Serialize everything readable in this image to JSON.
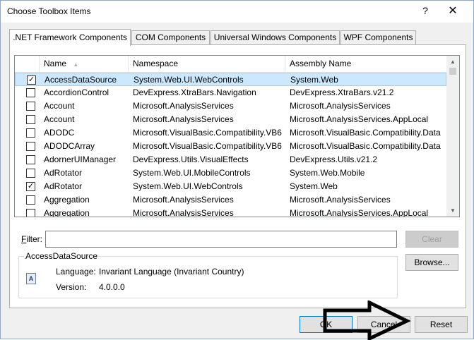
{
  "window": {
    "title": "Choose Toolbox Items",
    "help_glyph": "?",
    "close_glyph": "✕"
  },
  "tabs": [
    {
      "label": ".NET Framework Components",
      "active": true
    },
    {
      "label": "COM Components",
      "active": false
    },
    {
      "label": "Universal Windows Components",
      "active": false
    },
    {
      "label": "WPF Components",
      "active": false
    }
  ],
  "list": {
    "columns": [
      "Name",
      "Namespace",
      "Assembly Name"
    ],
    "rows": [
      {
        "checked": true,
        "name": "AccessDataSource",
        "namespace": "System.Web.UI.WebControls",
        "assembly": "System.Web",
        "selected": true
      },
      {
        "checked": false,
        "name": "AccordionControl",
        "namespace": "DevExpress.XtraBars.Navigation",
        "assembly": "DevExpress.XtraBars.v21.2"
      },
      {
        "checked": false,
        "name": "Account",
        "namespace": "Microsoft.AnalysisServices",
        "assembly": "Microsoft.AnalysisServices"
      },
      {
        "checked": false,
        "name": "Account",
        "namespace": "Microsoft.AnalysisServices",
        "assembly": "Microsoft.AnalysisServices.AppLocal"
      },
      {
        "checked": false,
        "name": "ADODC",
        "namespace": "Microsoft.VisualBasic.Compatibility.VB6",
        "assembly": "Microsoft.VisualBasic.Compatibility.Data"
      },
      {
        "checked": false,
        "name": "ADODCArray",
        "namespace": "Microsoft.VisualBasic.Compatibility.VB6",
        "assembly": "Microsoft.VisualBasic.Compatibility.Data"
      },
      {
        "checked": false,
        "name": "AdornerUIManager",
        "namespace": "DevExpress.Utils.VisualEffects",
        "assembly": "DevExpress.Utils.v21.2"
      },
      {
        "checked": false,
        "name": "AdRotator",
        "namespace": "System.Web.UI.MobileControls",
        "assembly": "System.Web.Mobile"
      },
      {
        "checked": true,
        "name": "AdRotator",
        "namespace": "System.Web.UI.WebControls",
        "assembly": "System.Web"
      },
      {
        "checked": false,
        "name": "Aggregation",
        "namespace": "Microsoft.AnalysisServices",
        "assembly": "Microsoft.AnalysisServices"
      },
      {
        "checked": false,
        "name": "Aggregation",
        "namespace": "Microsoft.AnalysisServices",
        "assembly": "Microsoft.AnalysisServices.AppLocal"
      }
    ]
  },
  "filter": {
    "label_prefix": "F",
    "label_rest": "ilter:",
    "value": "",
    "clear_label": "Clear"
  },
  "details": {
    "group_title": "AccessDataSource",
    "language_label": "Language:",
    "language_value": "Invariant Language (Invariant Country)",
    "version_label": "Version:",
    "version_value": "4.0.0.0",
    "browse_label": "Browse...",
    "icon_glyph": "A"
  },
  "footer": {
    "ok_label": "OK",
    "cancel_label": "Cancel",
    "reset_label": "Reset"
  },
  "colors": {
    "selection": "#cce8ff",
    "selection_border": "#99d1ff",
    "default_button_border": "#0078d7",
    "arrow": "#000000"
  }
}
